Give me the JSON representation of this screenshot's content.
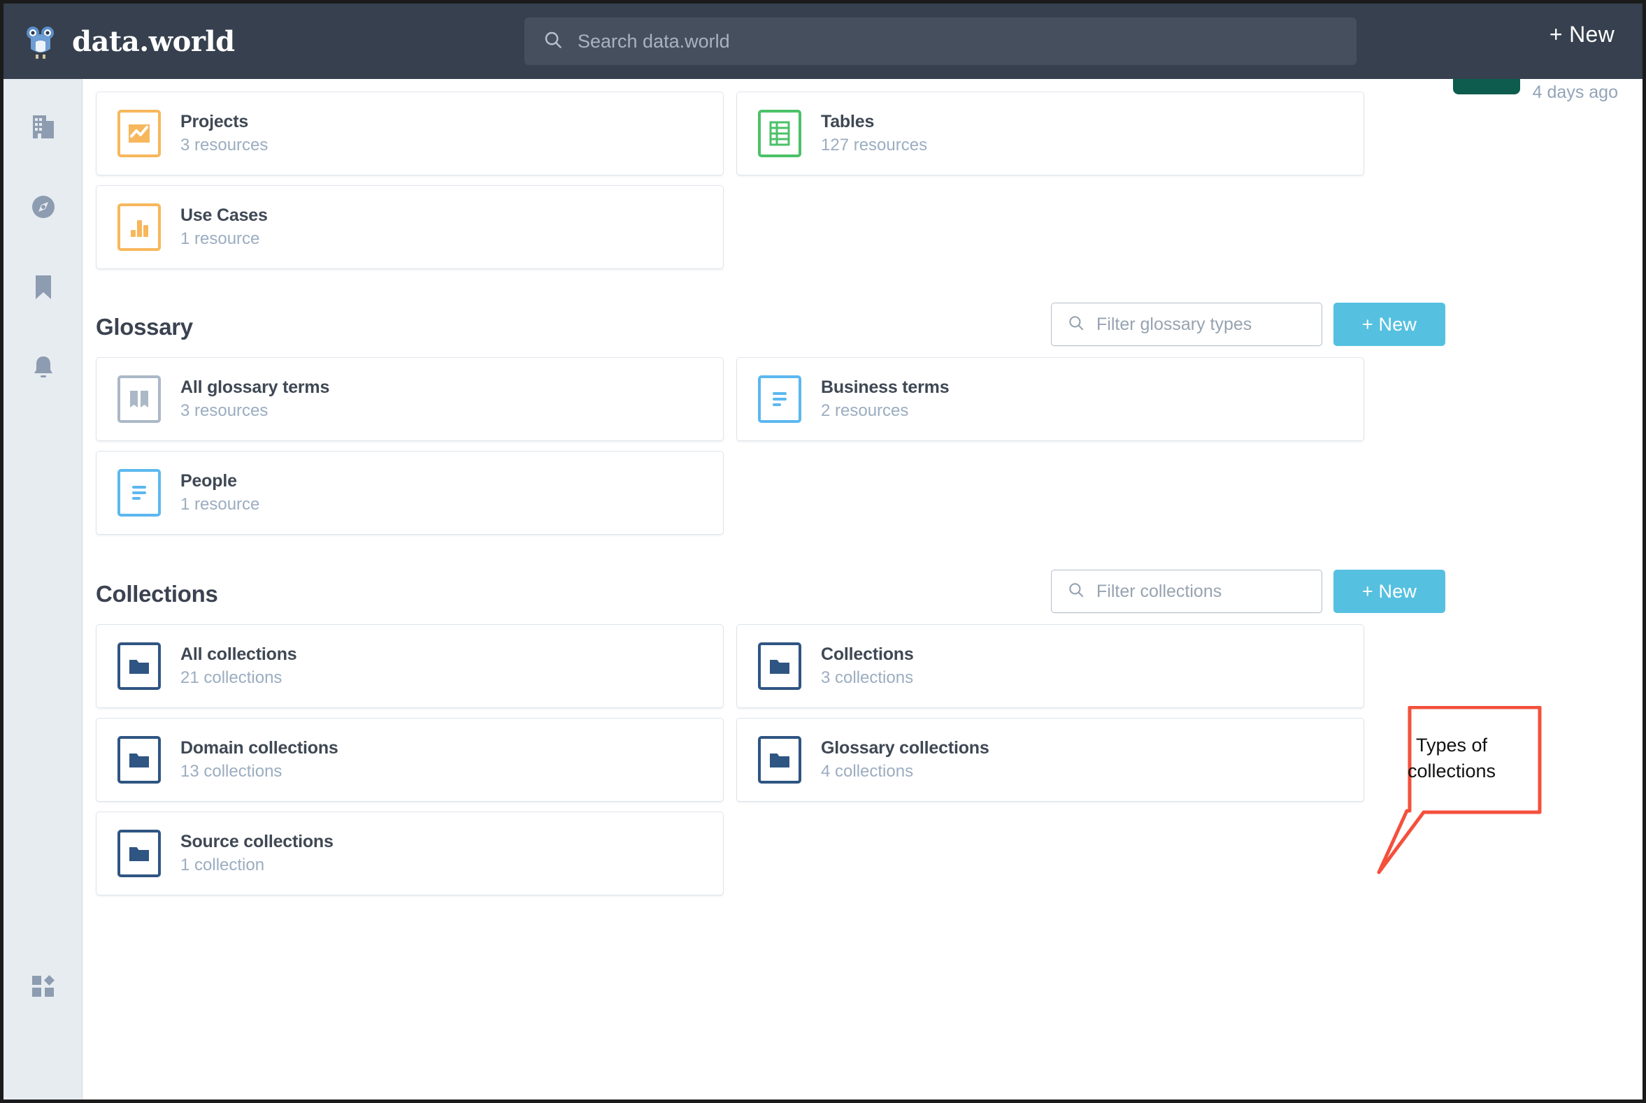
{
  "app": {
    "brand": "data.world",
    "logo_icon": "owl-logo-icon",
    "accent_blue": "#56c0e0",
    "navbar_bg": "#36404e"
  },
  "topnav": {
    "search": {
      "icon": "search-icon",
      "placeholder": "Search data.world",
      "value": ""
    },
    "new_label": "+ New"
  },
  "sidebar": {
    "items": [
      {
        "name": "organization",
        "icon": "building-icon"
      },
      {
        "name": "explore",
        "icon": "compass-icon"
      },
      {
        "name": "bookmarks",
        "icon": "bookmark-icon"
      },
      {
        "name": "notifications",
        "icon": "bell-icon"
      }
    ],
    "bottom": {
      "name": "integrations",
      "icon": "apps-grid-icon"
    }
  },
  "header_partial": {
    "timestamp": "4 days ago",
    "badge_color": "#0d5c4e"
  },
  "resources_section": {
    "cards": [
      {
        "title": "Projects",
        "sub": "3 resources",
        "icon": "line-chart-icon",
        "color": "orange"
      },
      {
        "title": "Tables",
        "sub": "127 resources",
        "icon": "table-grid-icon",
        "color": "green"
      },
      {
        "title": "Use Cases",
        "sub": "1 resource",
        "icon": "bar-chart-icon",
        "color": "orange"
      }
    ]
  },
  "glossary_section": {
    "title": "Glossary",
    "filter": {
      "icon": "search-icon",
      "placeholder": "Filter glossary types",
      "value": ""
    },
    "new_label": "+ New",
    "cards": [
      {
        "title": "All glossary terms",
        "sub": "3 resources",
        "icon": "book-icon",
        "color": "grey"
      },
      {
        "title": "Business terms",
        "sub": "2 resources",
        "icon": "document-lines-icon",
        "color": "blue"
      },
      {
        "title": "People",
        "sub": "1 resource",
        "icon": "document-lines-icon",
        "color": "blue"
      }
    ]
  },
  "collections_section": {
    "title": "Collections",
    "filter": {
      "icon": "search-icon",
      "placeholder": "Filter collections",
      "value": ""
    },
    "new_label": "+ New",
    "cards": [
      {
        "title": "All collections",
        "sub": "21 collections",
        "icon": "folder-icon",
        "color": "navy"
      },
      {
        "title": "Collections",
        "sub": "3 collections",
        "icon": "folder-icon",
        "color": "navy"
      },
      {
        "title": "Domain collections",
        "sub": "13 collections",
        "icon": "folder-icon",
        "color": "navy"
      },
      {
        "title": "Glossary collections",
        "sub": "4 collections",
        "icon": "folder-icon",
        "color": "navy"
      },
      {
        "title": "Source collections",
        "sub": "1 collection",
        "icon": "folder-icon",
        "color": "navy"
      }
    ]
  },
  "annotation": {
    "text": "Types of collections",
    "color": "#f4503c"
  }
}
